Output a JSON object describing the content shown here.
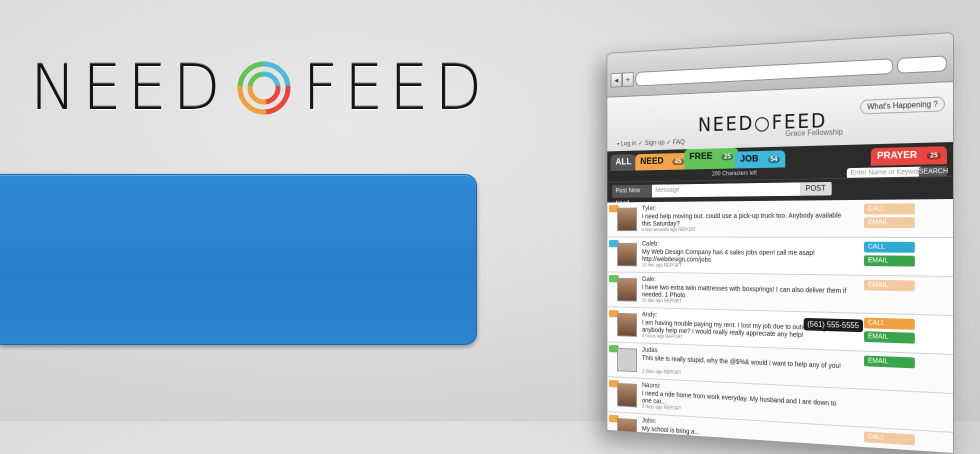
{
  "brand": {
    "left": "NEED",
    "right": "FEED"
  },
  "colors": {
    "hero_blue": "#2c84cd",
    "need": "#f3a34a",
    "free": "#62c45b",
    "job": "#3fb7d8",
    "prayer": "#e6463f",
    "call_green": "#3aa44a",
    "email_green": "#3aa44a",
    "call_blue": "#30a9d0",
    "call_orange": "#f0a040"
  },
  "browser": {
    "account_links": "▪ Log in  ✓ Sign up  ✓ FAQ",
    "whats_happening": "What's Happening ?",
    "logo": "NEED○FEED",
    "church": "Grace Fellowship",
    "categories": [
      {
        "label": "ALL",
        "count": ""
      },
      {
        "label": "NEED",
        "count": "45"
      },
      {
        "label": "FREE",
        "count": "25"
      },
      {
        "label": "JOB",
        "count": "54"
      },
      {
        "label": "PRAYER",
        "count": "25"
      }
    ],
    "search_placeholder": "Enter Name or Keyword",
    "search_button": "SEARCH",
    "chars_left": "200 Characters left",
    "post_need": "Post New Need",
    "message_placeholder": "Message",
    "post_button": "POST",
    "feed": [
      {
        "name": "Tyler:",
        "text": "I need help moving out. could use a pick-up truck too. Anybody available this Saturday?",
        "meta": "a few seconds ago  REPORT",
        "tag": "#f3a34a",
        "actions": [
          "CALL",
          "EMAIL"
        ]
      },
      {
        "name": "Caleb:",
        "text": "My Web Design Company has 4 sales jobs open!  call me asap!  http://webdesign.com/jobs",
        "meta": "10 min ago  REPORT",
        "tag": "#3fb7d8",
        "actions": [
          "CALL",
          "EMAIL"
        ]
      },
      {
        "name": "Gale:",
        "text": "I have two extra twin mattresses with boxsprings!  I can also deliver them if needed.  1 Photo",
        "meta": "10 min ago  REPORT",
        "tag": "#62c45b",
        "actions": [
          "EMAIL"
        ]
      },
      {
        "name": "Andy:",
        "text": "I am having trouble paying my rent. I lost my job due to outsourcing. Can anybody help me? I would really really appreciate any help!",
        "meta": "3 hours ago  REPORT",
        "tag": "#f3a34a",
        "actions": [
          "CALL",
          "EMAIL"
        ],
        "callout": "(561) 555-5555"
      },
      {
        "name": "Judas",
        "text": "This site is really stupid, why the @$%& would i want to help any of you!",
        "meta": "2 days ago  REPORT",
        "tag": "#62c45b",
        "actions": [
          "EMAIL"
        ]
      },
      {
        "name": "Naomi:",
        "text": "I need a ride home from work everyday.  My husband and I are down to one car...",
        "meta": "2 days ago  REPORT",
        "tag": "#f3a34a",
        "actions": []
      },
      {
        "name": "John:",
        "text": "My school is bring a...",
        "meta": "",
        "tag": "#f3a34a",
        "actions": [
          "CALL"
        ]
      }
    ]
  }
}
